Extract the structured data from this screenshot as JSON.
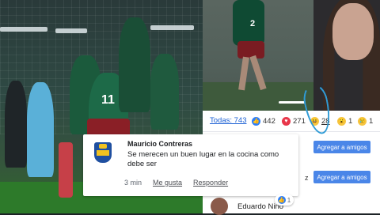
{
  "reactions": {
    "all_label": "Todas: 743",
    "like_count": "442",
    "love_count": "271",
    "haha_count": "28",
    "wow_count": "1",
    "sad_count": "1",
    "icons": {
      "like": "like-icon",
      "love": "love-icon",
      "haha": "haha-icon",
      "wow": "wow-icon",
      "sad": "sad-icon"
    }
  },
  "friend_rows": [
    {
      "button_label": "Agregar a amigos"
    },
    {
      "letter": "z",
      "button_label": "Agregar a amigos"
    },
    {
      "name": "Eduardo Niño"
    }
  ],
  "comment": {
    "author": "Mauricio Contreras",
    "text": "Se merecen un buen lugar en la cocina como debe ser",
    "time": "3 min",
    "like_action": "Me gusta",
    "reply_action": "Responder",
    "like_count": "1"
  },
  "photo_left": {
    "jersey_number": "11"
  },
  "photo_right": {
    "jersey_number": "2"
  },
  "colors": {
    "facebook_blue": "#4a86e8",
    "annotation_circle": "#2f9bd6"
  }
}
